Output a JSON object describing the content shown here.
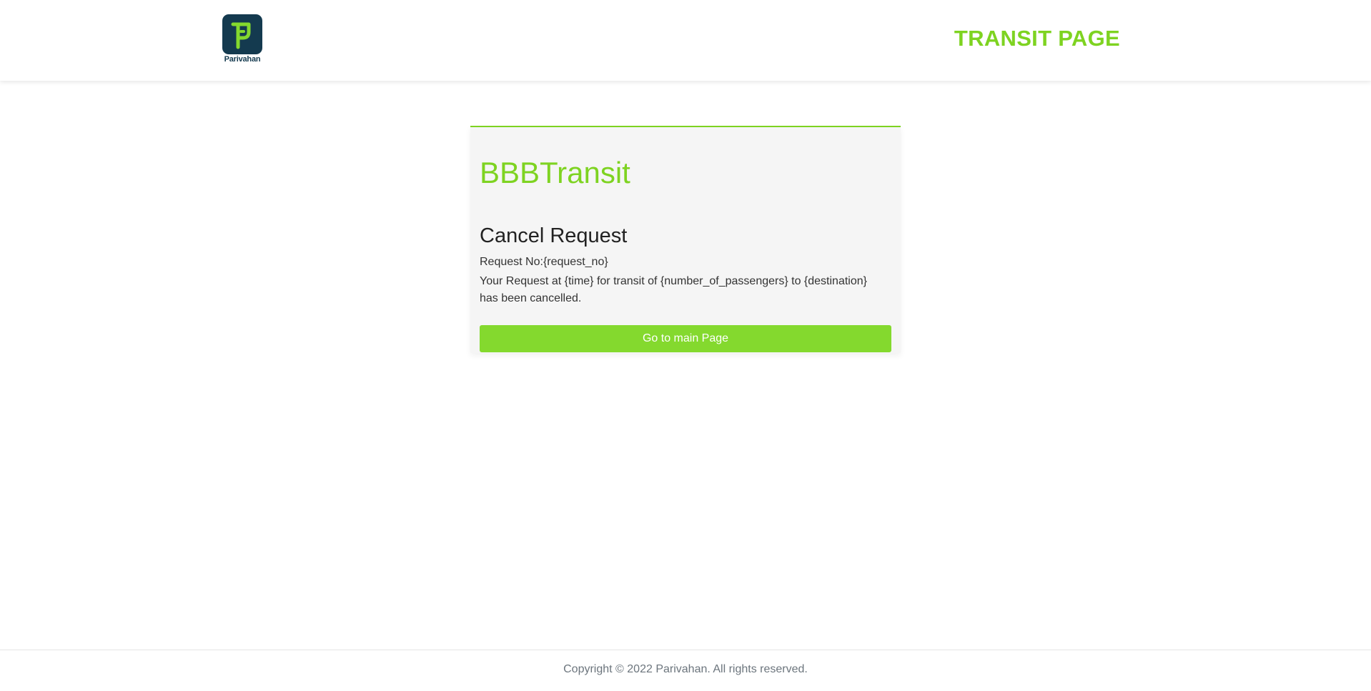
{
  "colors": {
    "accent": "#7ed321",
    "button": "#84d92e",
    "logo_bg": "#143a4f",
    "logo_text": "#143a4f"
  },
  "header": {
    "logo_icon": "parivahan-logo-icon",
    "logo_text": "Parivahan",
    "title": "TRANSIT PAGE"
  },
  "card": {
    "brand": "BBBTransit",
    "heading": "Cancel Request",
    "request_no": "Request No:{request_no}",
    "message": "Your Request at {time} for transit of {number_of_passengers} to {destination} has been cancelled.",
    "button_label": "Go to main Page"
  },
  "footer": {
    "copyright": "Copyright © 2022 Parivahan. All rights reserved."
  }
}
